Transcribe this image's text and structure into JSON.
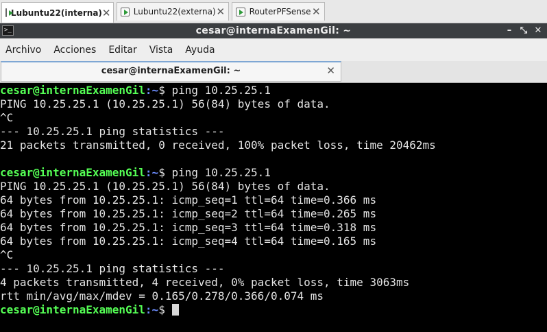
{
  "vm_tabs": [
    {
      "label": "Lubuntu22(interna)",
      "close": "✕"
    },
    {
      "label": "Lubuntu22(externa)",
      "close": "✕"
    },
    {
      "label": "RouterPFSense",
      "close": "✕"
    }
  ],
  "window": {
    "title": "cesar@internaExamenGil: ~",
    "icon_text": ">_",
    "minimize": "–",
    "maximize": "⤡",
    "close": "✕"
  },
  "menu": [
    "Archivo",
    "Acciones",
    "Editar",
    "Vista",
    "Ayuda"
  ],
  "term_tab": {
    "title": "cesar@internaExamenGil: ~",
    "close": "✕"
  },
  "terminal": {
    "prompt_user": "cesar@internaExamenGil",
    "prompt_path": ":~",
    "prompt_symbol": "$ ",
    "command": "ping 10.25.25.1",
    "block1": [
      "PING 10.25.25.1 (10.25.25.1) 56(84) bytes of data.",
      "^C",
      "--- 10.25.25.1 ping statistics ---",
      "21 packets transmitted, 0 received, 100% packet loss, time 20462ms",
      ""
    ],
    "block2": [
      "PING 10.25.25.1 (10.25.25.1) 56(84) bytes of data.",
      "64 bytes from 10.25.25.1: icmp_seq=1 ttl=64 time=0.366 ms",
      "64 bytes from 10.25.25.1: icmp_seq=2 ttl=64 time=0.265 ms",
      "64 bytes from 10.25.25.1: icmp_seq=3 ttl=64 time=0.318 ms",
      "64 bytes from 10.25.25.1: icmp_seq=4 ttl=64 time=0.165 ms",
      "^C",
      "--- 10.25.25.1 ping statistics ---",
      "4 packets transmitted, 4 received, 0% packet loss, time 3063ms",
      "rtt min/avg/max/mdev = 0.165/0.278/0.366/0.074 ms"
    ]
  }
}
